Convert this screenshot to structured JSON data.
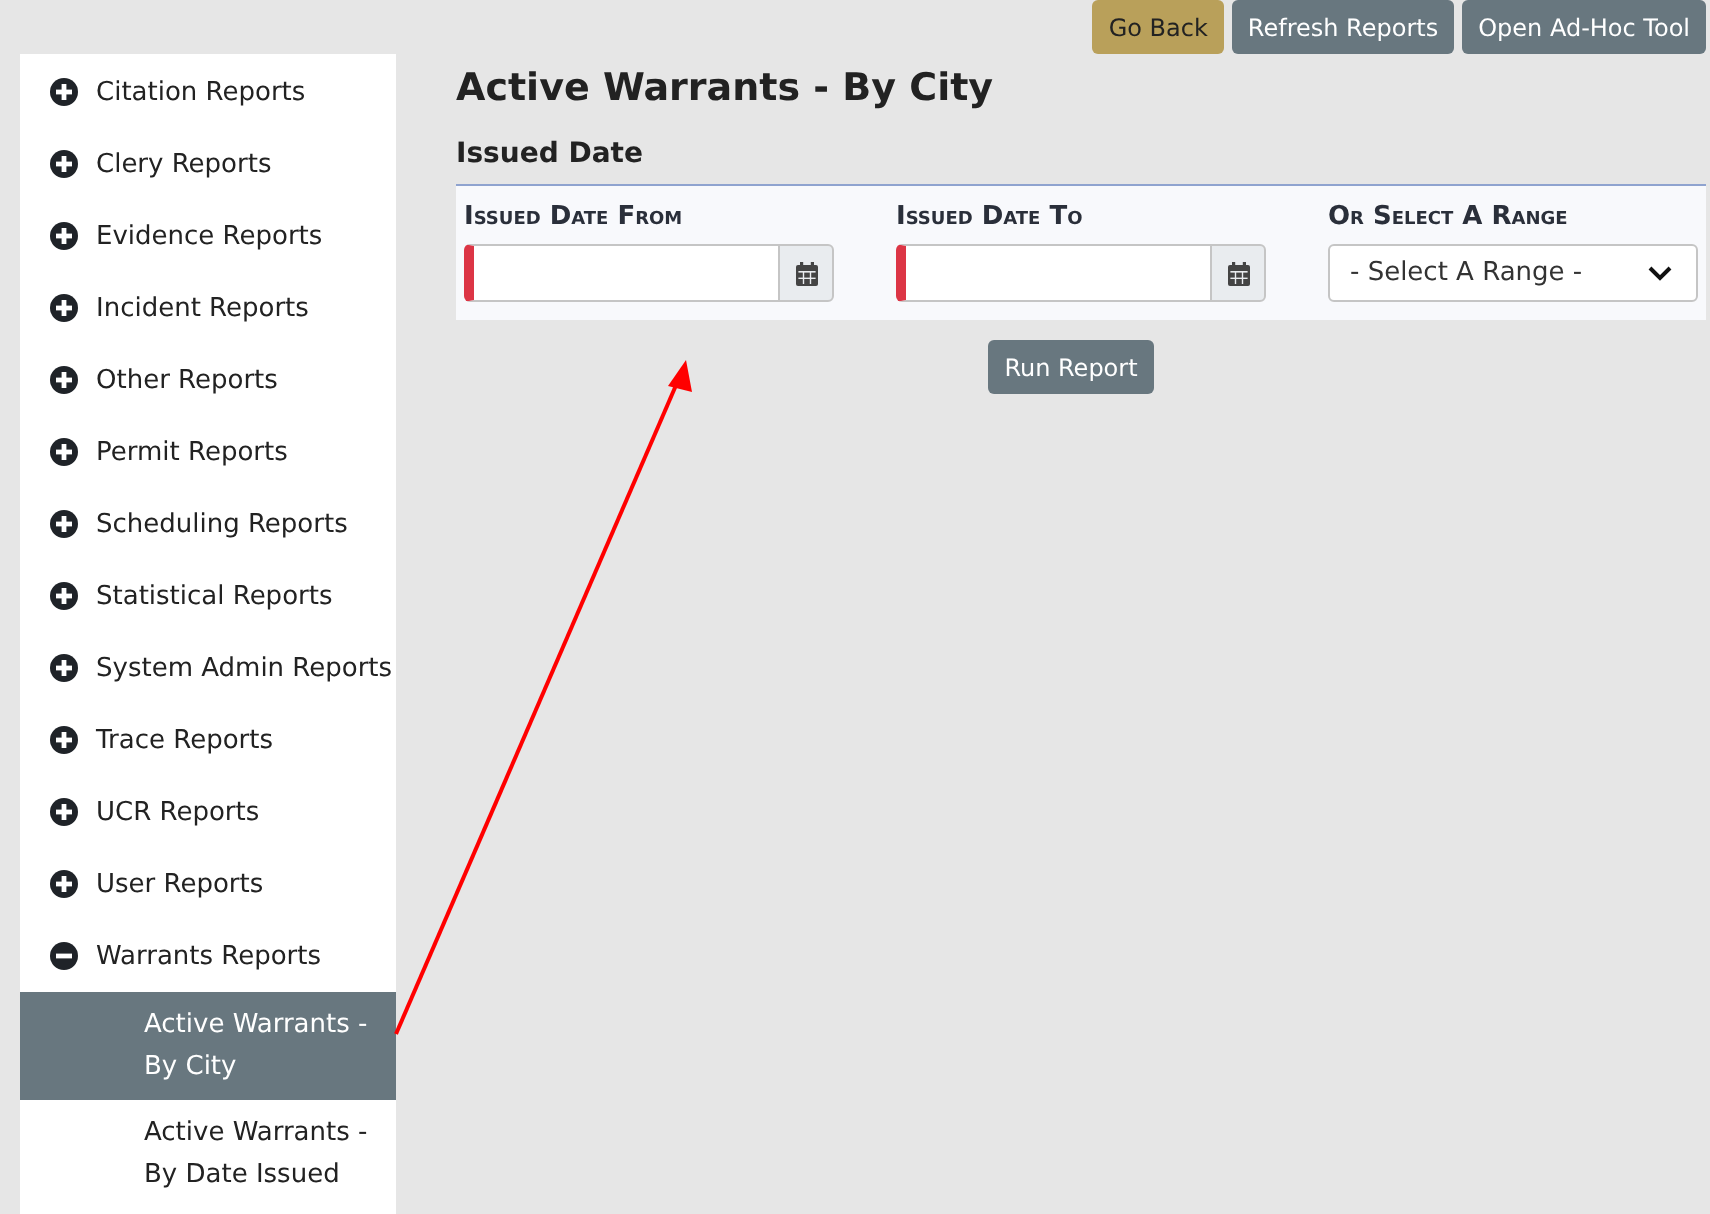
{
  "toolbar": {
    "buttons": [
      {
        "label": "Go Back",
        "kind": "back"
      },
      {
        "label": "Refresh Reports",
        "kind": "action"
      },
      {
        "label": "Open Ad-Hoc Tool",
        "kind": "action"
      }
    ]
  },
  "sidebar": {
    "items": [
      {
        "label": "Citation Reports",
        "expanded": false
      },
      {
        "label": "Clery Reports",
        "expanded": false
      },
      {
        "label": "Evidence Reports",
        "expanded": false
      },
      {
        "label": "Incident Reports",
        "expanded": false
      },
      {
        "label": "Other Reports",
        "expanded": false
      },
      {
        "label": "Permit Reports",
        "expanded": false
      },
      {
        "label": "Scheduling Reports",
        "expanded": false
      },
      {
        "label": "Statistical Reports",
        "expanded": false
      },
      {
        "label": "System Admin Reports",
        "expanded": false
      },
      {
        "label": "Trace Reports",
        "expanded": false
      },
      {
        "label": "UCR Reports",
        "expanded": false
      },
      {
        "label": "User Reports",
        "expanded": false
      },
      {
        "label": "Warrants Reports",
        "expanded": true,
        "children": [
          {
            "label": "Active Warrants - By City",
            "selected": true
          },
          {
            "label": "Active Warrants - By Date Issued",
            "selected": false
          }
        ]
      }
    ]
  },
  "page": {
    "title": "Active Warrants - By City",
    "section": "Issued Date",
    "fields": [
      {
        "label": "Issued Date From",
        "kind": "date",
        "required": true
      },
      {
        "label": "Issued Date To",
        "kind": "date",
        "required": true
      },
      {
        "label": "Or Select A Range",
        "kind": "select",
        "placeholder": "- Select A Range -"
      }
    ],
    "run_button": "Run Report"
  },
  "annotation": {
    "kind": "arrow"
  }
}
